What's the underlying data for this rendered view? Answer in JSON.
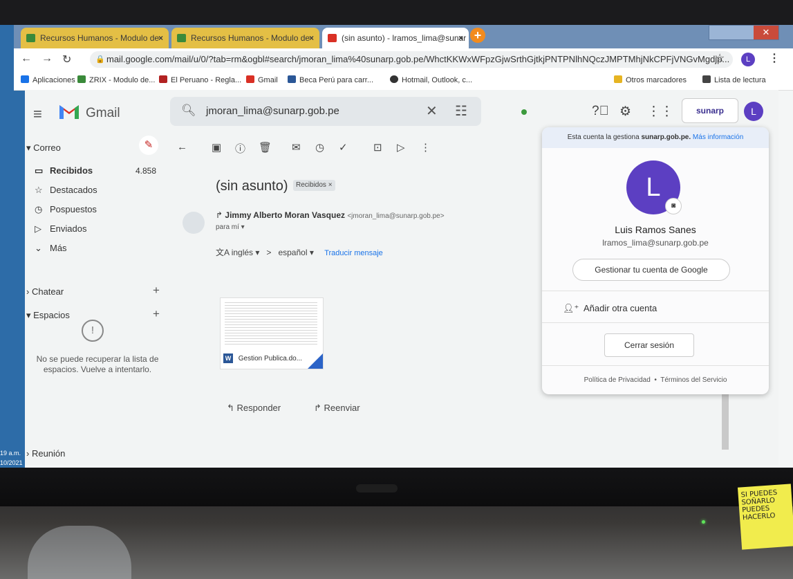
{
  "browser": {
    "tabs": [
      {
        "label": "Recursos Humanos - Modulo de",
        "state": "inactive"
      },
      {
        "label": "Recursos Humanos - Modulo de",
        "state": "inactive"
      },
      {
        "label": "(sin asunto) - lramos_lima@sunar",
        "state": "active"
      }
    ],
    "tab_close": "×",
    "new_tab": "+",
    "url": "mail.google.com/mail/u/0/?tab=rm&ogbl#search/jmoran_lima%40sunarp.gob.pe/WhctKKWxWFpzGjwSrthGjtkjPNTPNlhNQczJMPTMhjNkCPFjVNGvMgdjp...",
    "profile_initial": "L",
    "bookmarks": [
      {
        "label": "Aplicaciones",
        "icon": "apps-icon"
      },
      {
        "label": "ZRIX - Modulo de...",
        "icon": "zrix-icon"
      },
      {
        "label": "El Peruano - Regla...",
        "icon": "peruano-icon"
      },
      {
        "label": "Gmail",
        "icon": "gmail-icon"
      },
      {
        "label": "Beca Perú para carr...",
        "icon": "beca-icon"
      },
      {
        "label": "Hotmail, Outlook, c...",
        "icon": "outlook-icon"
      },
      {
        "label": "Otros marcadores",
        "icon": "folder-icon"
      },
      {
        "label": "Lista de lectura",
        "icon": "reading-list-icon"
      }
    ]
  },
  "gmail": {
    "app_title": "Gmail",
    "search_value": "jmoran_lima@sunarp.gob.pe",
    "org_badge": "sunarp",
    "avatar_initial": "L",
    "nav": {
      "mail_section": "Correo",
      "items": [
        {
          "label": "Recibidos",
          "icon": "inbox-icon",
          "count": "4.858"
        },
        {
          "label": "Destacados",
          "icon": "star-icon"
        },
        {
          "label": "Pospuestos",
          "icon": "clock-icon"
        },
        {
          "label": "Enviados",
          "icon": "send-icon"
        },
        {
          "label": "Más",
          "icon": "chevron-down-icon"
        }
      ],
      "chat_section": "Chatear",
      "spaces_section": "Espacios",
      "spaces_error": "No se puede recuperar la lista de espacios. Vuelve a intentarlo.",
      "meeting_section": "Reunión"
    },
    "message": {
      "subject": "(sin asunto)",
      "label_chip": "Recibidos ×",
      "sender_name": "Jimmy Alberto Moran Vasquez",
      "sender_email": "<jmoran_lima@sunarp.gob.pe>",
      "to": "para mí ▾",
      "translate_from": "inglés ▾",
      "translate_arrow": ">",
      "translate_to": "español ▾",
      "translate_link": "Traducir mensaje",
      "attachment_name": "Gestion Publica.do...",
      "reply": "Responder",
      "forward": "Reenviar"
    },
    "account_popup": {
      "managed_prefix": "Esta cuenta la gestiona",
      "managed_domain": "sunarp.gob.pe.",
      "managed_more": "Más información",
      "initial": "L",
      "name": "Luis Ramos Sanes",
      "email": "lramos_lima@sunarp.gob.pe",
      "manage_button": "Gestionar tu cuenta de Google",
      "add_account": "Añadir otra cuenta",
      "logout_button": "Cerrar sesión",
      "privacy": "Política de Privacidad",
      "separator": "•",
      "terms": "Términos del Servicio"
    }
  },
  "taskbar": {
    "time": "19 a.m.",
    "date": "10/2021"
  },
  "sticky_note": "SI PUEDES SOÑARLO PUEDES HACERLO",
  "colors": {
    "accent": "#5c3fc2",
    "link": "#1a73e8",
    "tab_inactive": "#e4bf45"
  }
}
